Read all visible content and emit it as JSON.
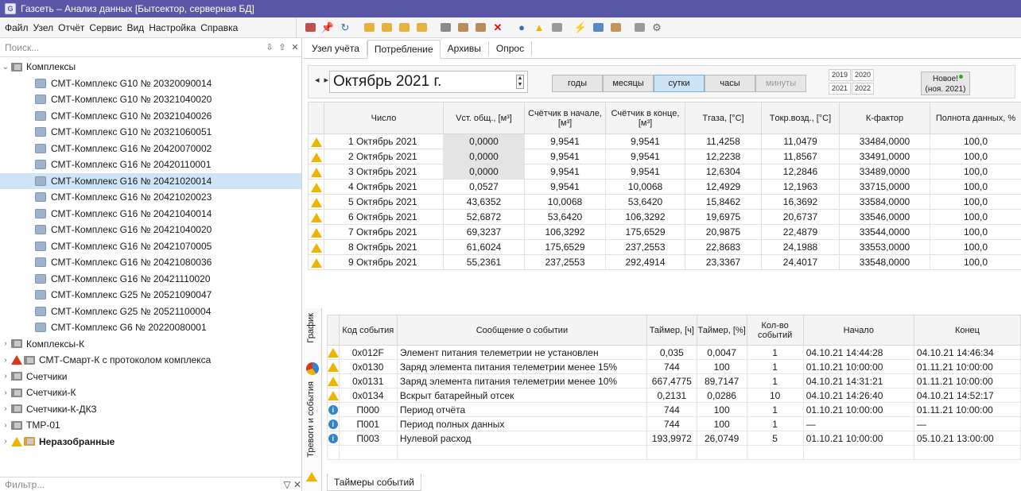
{
  "window": {
    "title": "Газсеть – Анализ данных [Бытсектор, серверная БД]"
  },
  "menu": [
    "Файл",
    "Узел",
    "Отчёт",
    "Сервис",
    "Вид",
    "Настройка",
    "Справка"
  ],
  "left": {
    "search_placeholder": "Поиск...",
    "filter_placeholder": "Фильтр...",
    "tree": [
      {
        "label": "Комплексы",
        "type": "group-open"
      },
      {
        "label": "СМТ-Комплекс G10 № 20320090014",
        "type": "child"
      },
      {
        "label": "СМТ-Комплекс G10 № 20321040020",
        "type": "child"
      },
      {
        "label": "СМТ-Комплекс G10 № 20321040026",
        "type": "child"
      },
      {
        "label": "СМТ-Комплекс G10 № 20321060051",
        "type": "child"
      },
      {
        "label": "СМТ-Комплекс G16 № 20420070002",
        "type": "child"
      },
      {
        "label": "СМТ-Комплекс G16 № 20420110001",
        "type": "child"
      },
      {
        "label": "СМТ-Комплекс G16 № 20421020014",
        "type": "child-selected"
      },
      {
        "label": "СМТ-Комплекс G16 № 20421020023",
        "type": "child"
      },
      {
        "label": "СМТ-Комплекс G16 № 20421040014",
        "type": "child"
      },
      {
        "label": "СМТ-Комплекс G16 № 20421040020",
        "type": "child"
      },
      {
        "label": "СМТ-Комплекс G16 № 20421070005",
        "type": "child"
      },
      {
        "label": "СМТ-Комплекс G16 № 20421080036",
        "type": "child"
      },
      {
        "label": "СМТ-Комплекс G16 № 20421110020",
        "type": "child"
      },
      {
        "label": "СМТ-Комплекс G25 № 20521090047",
        "type": "child"
      },
      {
        "label": "СМТ-Комплекс G25 № 20521100004",
        "type": "child"
      },
      {
        "label": "СМТ-Комплекс G6 № 20220080001",
        "type": "child"
      },
      {
        "label": "Комплексы-К",
        "type": "group"
      },
      {
        "label": "СМТ-Смарт-К с протоколом комплекса",
        "type": "group-warn-red"
      },
      {
        "label": "Счетчики",
        "type": "group"
      },
      {
        "label": "Счетчики-К",
        "type": "group"
      },
      {
        "label": "Счетчики-К-ДКЗ",
        "type": "group"
      },
      {
        "label": "ТМР-01",
        "type": "group"
      },
      {
        "label": "Неразобранные",
        "type": "group-warn-bold"
      }
    ]
  },
  "tabs": [
    "Узел учёта",
    "Потребление",
    "Архивы",
    "Опрос"
  ],
  "datebar": {
    "month": "Октябрь 2021 г.",
    "periods": [
      "годы",
      "месяцы",
      "сутки",
      "часы",
      "минуты"
    ],
    "years": [
      "2019",
      "2020",
      "2021",
      "2022"
    ],
    "new_label": "Новое!",
    "new_date": "(ноя. 2021)"
  },
  "table1": {
    "headers": [
      "Число",
      "Vст. общ., [м³]",
      "Счётчик в начале, [м³]",
      "Счётчик в конце, [м³]",
      "Tгаза, [°C]",
      "Tокр.возд., [°C]",
      "К-фактор",
      "Полнота данных, %"
    ],
    "rows": [
      [
        "1 Октябрь 2021",
        "0,0000",
        "9,9541",
        "9,9541",
        "11,4258",
        "11,0479",
        "33484,0000",
        "100,0"
      ],
      [
        "2 Октябрь 2021",
        "0,0000",
        "9,9541",
        "9,9541",
        "12,2238",
        "11,8567",
        "33491,0000",
        "100,0"
      ],
      [
        "3 Октябрь 2021",
        "0,0000",
        "9,9541",
        "9,9541",
        "12,6304",
        "12,2846",
        "33489,0000",
        "100,0"
      ],
      [
        "4 Октябрь 2021",
        "0,0527",
        "9,9541",
        "10,0068",
        "12,4929",
        "12,1963",
        "33715,0000",
        "100,0"
      ],
      [
        "5 Октябрь 2021",
        "43,6352",
        "10,0068",
        "53,6420",
        "15,8462",
        "16,3692",
        "33584,0000",
        "100,0"
      ],
      [
        "6 Октябрь 2021",
        "52,6872",
        "53,6420",
        "106,3292",
        "19,6975",
        "20,6737",
        "33546,0000",
        "100,0"
      ],
      [
        "7 Октябрь 2021",
        "69,3237",
        "106,3292",
        "175,6529",
        "20,9875",
        "22,4879",
        "33544,0000",
        "100,0"
      ],
      [
        "8 Октябрь 2021",
        "61,6024",
        "175,6529",
        "237,2553",
        "22,8683",
        "24,1988",
        "33553,0000",
        "100,0"
      ],
      [
        "9 Октябрь 2021",
        "55,2361",
        "237,2553",
        "292,4914",
        "23,3367",
        "24,4017",
        "33548,0000",
        "100,0"
      ]
    ]
  },
  "side_tabs": [
    "График",
    "Тревоги и события"
  ],
  "table2": {
    "headers": [
      "Код события",
      "Сообщение о событии",
      "Таймер, [ч]",
      "Таймер, [%]",
      "Кол-во событий",
      "Начало",
      "Конец"
    ],
    "rows": [
      {
        "icon": "warning",
        "cells": [
          "0x012F",
          "Элемент питания телеметрии не установлен",
          "0,035",
          "0,0047",
          "1",
          "04.10.21 14:44:28",
          "04.10.21 14:46:34"
        ]
      },
      {
        "icon": "warning",
        "cells": [
          "0x0130",
          "Заряд элемента питания телеметрии менее 15%",
          "744",
          "100",
          "1",
          "01.10.21 10:00:00",
          "01.11.21 10:00:00"
        ]
      },
      {
        "icon": "warning",
        "cells": [
          "0x0131",
          "Заряд элемента питания телеметрии менее 10%",
          "667,4775",
          "89,7147",
          "1",
          "04.10.21 14:31:21",
          "01.11.21 10:00:00"
        ]
      },
      {
        "icon": "warning",
        "cells": [
          "0x0134",
          "Вскрыт батарейный отсек",
          "0,2131",
          "0,0286",
          "10",
          "04.10.21 14:26:40",
          "04.10.21 14:52:17"
        ]
      },
      {
        "icon": "info",
        "cells": [
          "П000",
          "Период отчёта",
          "744",
          "100",
          "1",
          "01.10.21 10:00:00",
          "01.11.21 10:00:00"
        ]
      },
      {
        "icon": "info",
        "cells": [
          "П001",
          "Период полных данных",
          "744",
          "100",
          "1",
          "—",
          "—"
        ]
      },
      {
        "icon": "info",
        "cells": [
          "П003",
          "Нулевой расход",
          "193,9972",
          "26,0749",
          "5",
          "01.10.21 10:00:00",
          "05.10.21 13:00:00"
        ]
      }
    ]
  },
  "bottom_tab": "Таймеры событий",
  "colors": {
    "titlebar": "#5b57a8",
    "selected": "#cfe4f7",
    "warning": "#f0b400",
    "error": "#d8361b",
    "info": "#2f84d0"
  }
}
